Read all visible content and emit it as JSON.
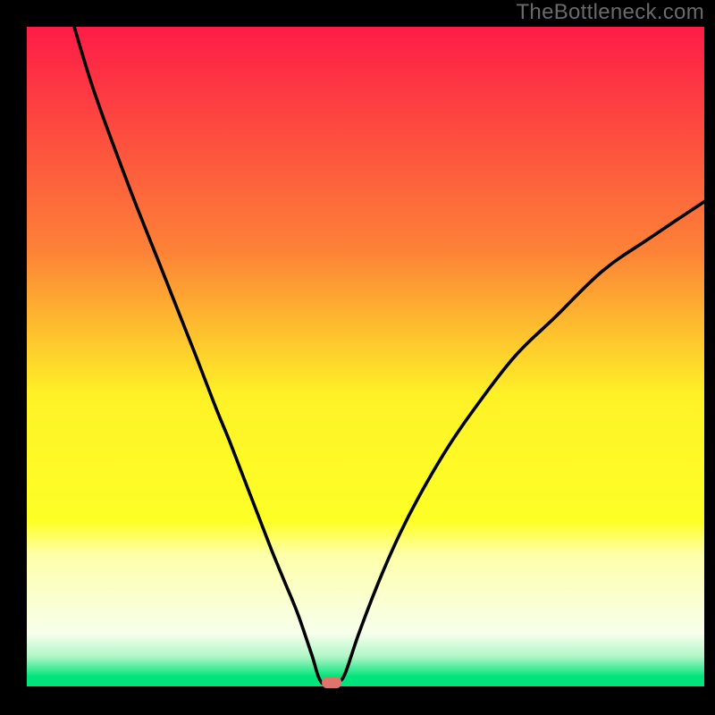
{
  "watermark": "TheBottleneck.com",
  "plot": {
    "inner_left": 30,
    "inner_top": 30,
    "inner_right": 788,
    "inner_bottom": 768,
    "x_domain": [
      0,
      100
    ],
    "y_domain": [
      0,
      100
    ]
  },
  "chart_data": {
    "type": "line",
    "title": "",
    "xlabel": "",
    "ylabel": "",
    "xlim": [
      0,
      100
    ],
    "ylim": [
      0,
      100
    ],
    "series": [
      {
        "name": "bottleneck-curve",
        "x": [
          7,
          10,
          15,
          20,
          25,
          28,
          30,
          33,
          36,
          38,
          40,
          42,
          43.5,
          45.5,
          46,
          47,
          49,
          52,
          55,
          58,
          62,
          66,
          72,
          78,
          85,
          92,
          100
        ],
        "y": [
          100,
          90,
          76,
          63,
          50,
          42,
          37,
          29,
          21,
          16,
          11,
          5,
          0.6,
          0.6,
          0.7,
          2,
          8,
          16,
          23,
          29,
          36,
          42,
          50,
          56,
          63,
          68,
          73.5
        ]
      }
    ],
    "marker": {
      "x": 45,
      "y": 0.6,
      "name": "optimal-point"
    },
    "flat_band": {
      "y": 0.6,
      "x_start": 43.5,
      "x_end": 45.5
    },
    "background_gradient": {
      "stops": [
        {
          "offset": 0.0,
          "color": "#fd1c47"
        },
        {
          "offset": 0.34,
          "color": "#fd8237"
        },
        {
          "offset": 0.56,
          "color": "#fef227"
        },
        {
          "offset": 0.75,
          "color": "#feff27"
        },
        {
          "offset": 0.8,
          "color": "#feffa9"
        },
        {
          "offset": 0.92,
          "color": "#f7ffed"
        },
        {
          "offset": 0.955,
          "color": "#aef6c6"
        },
        {
          "offset": 0.985,
          "color": "#01e47b"
        },
        {
          "offset": 1.0,
          "color": "#01e47b"
        }
      ]
    }
  }
}
